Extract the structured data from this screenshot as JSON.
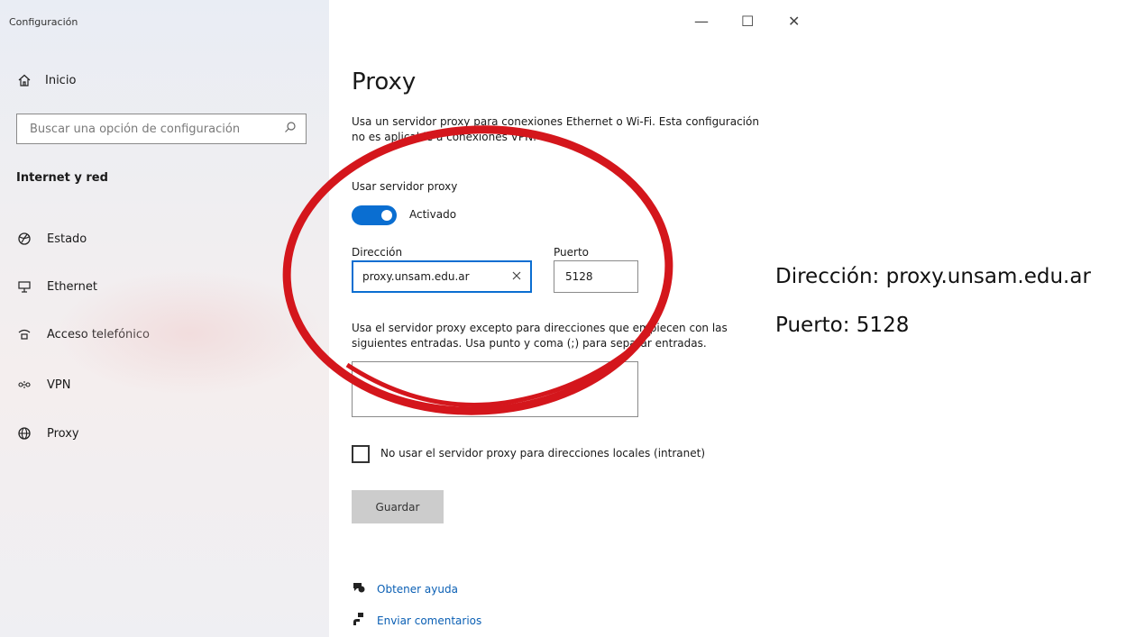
{
  "window": {
    "app_title": "Configuración",
    "controls": {
      "minimize": "—",
      "maximize": "☐",
      "close": "✕"
    }
  },
  "sidebar": {
    "home": {
      "icon": "home-icon",
      "label": "Inicio"
    },
    "search": {
      "placeholder": "Buscar una opción de configuración",
      "icon": "search-icon"
    },
    "section_title": "Internet y red",
    "items": [
      {
        "icon": "globe-status-icon",
        "label": "Estado"
      },
      {
        "icon": "ethernet-icon",
        "label": "Ethernet"
      },
      {
        "icon": "dialup-icon",
        "label": "Acceso telefónico"
      },
      {
        "icon": "vpn-icon",
        "label": "VPN"
      },
      {
        "icon": "proxy-globe-icon",
        "label": "Proxy"
      }
    ]
  },
  "main": {
    "title": "Proxy",
    "description": "Usa un servidor proxy para conexiones Ethernet o Wi-Fi. Esta configuración no es aplicable a conexiones VPN.",
    "use_proxy_label": "Usar servidor proxy",
    "toggle_state": "Activado",
    "address_label": "Dirección",
    "address_value": "proxy.unsam.edu.ar",
    "port_label": "Puerto",
    "port_value": "5128",
    "exceptions_text": "Usa el servidor proxy excepto para direcciones que empiecen con las siguientes entradas. Usa punto y coma (;) para separar entradas.",
    "exceptions_value": "",
    "local_checkbox_label": "No usar el servidor proxy para direcciones locales (intranet)",
    "save_label": "Guardar",
    "help_link": "Obtener ayuda",
    "feedback_link": "Enviar comentarios"
  },
  "annotation": {
    "line1": "Dirección: proxy.unsam.edu.ar",
    "line2": "Puerto: 5128",
    "ellipse_color": "#d4161c"
  },
  "colors": {
    "accent": "#0a6ed1",
    "link": "#0a5fb4"
  }
}
